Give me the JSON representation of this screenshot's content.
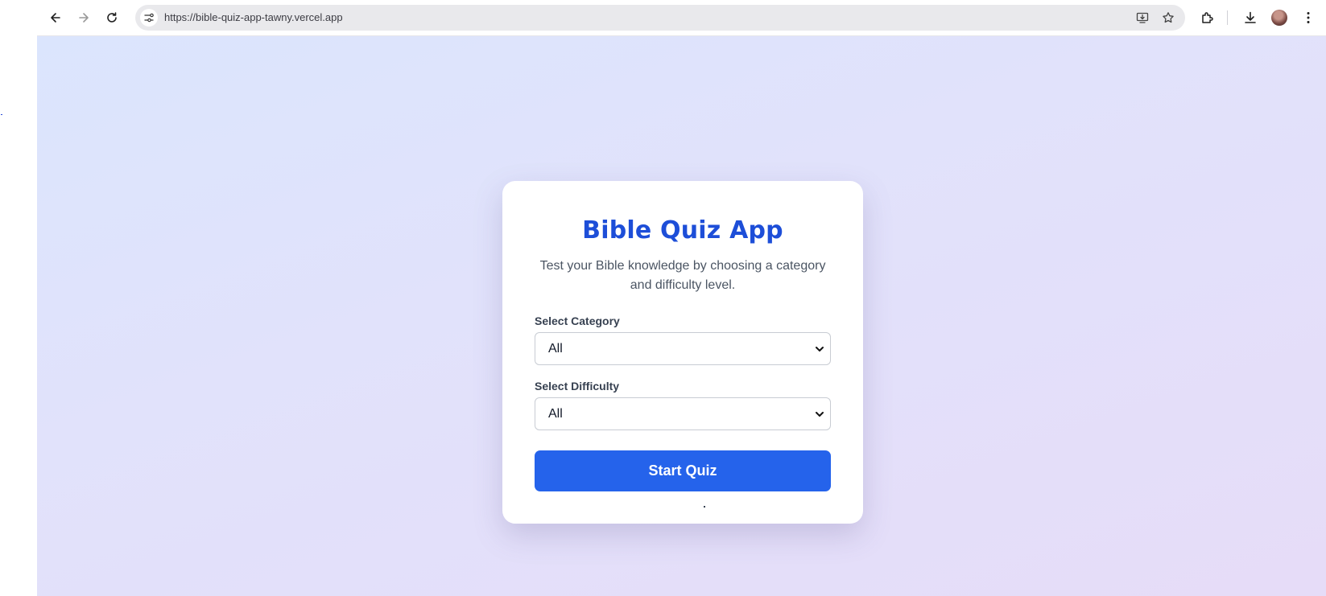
{
  "browser": {
    "url": "https://bible-quiz-app-tawny.vercel.app",
    "icons": [
      "back-arrow-icon",
      "forward-arrow-icon",
      "reload-icon",
      "site-info-icon",
      "install-app-icon",
      "bookmark-star-icon",
      "extensions-icon",
      "download-icon",
      "profile-avatar",
      "more-menu-icon"
    ]
  },
  "quiz_card": {
    "title": "Bible Quiz App",
    "subtitle": "Test your Bible knowledge by choosing a category and difficulty level.",
    "category_label": "Select Category",
    "category_value": "All",
    "difficulty_label": "Select Difficulty",
    "difficulty_value": "All",
    "start_button": "Start Quiz"
  },
  "colors": {
    "accent": "#2563eb",
    "title": "#1d4ed8",
    "background_start": "#dbe5fd",
    "background_end": "#e6dcf8"
  }
}
